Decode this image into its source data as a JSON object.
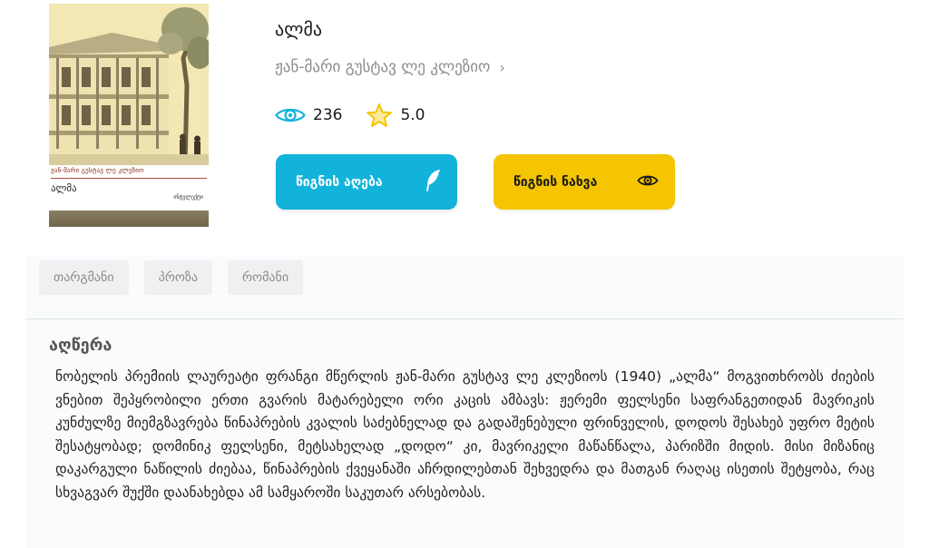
{
  "book": {
    "title": "ალმა",
    "author": "ჟან-მარი გუსტავ ლე კლეზიო",
    "views": "236",
    "rating": "5.0",
    "cover": {
      "author_line": "ჟან-მარი გუსტავ ლე კლეზიო",
      "title": "ალმა",
      "publisher": "ინტელექტი"
    }
  },
  "actions": {
    "take_label": "წიგნის აღება",
    "read_label": "წიგნის ნახვა"
  },
  "tags": [
    "თარგმანი",
    "პროზა",
    "რომანი"
  ],
  "description": {
    "heading": "აღწერა",
    "text": "ნობელის პრემიის ლაურეატი ფრანგი მწერლის ჟან-მარი გუსტავ ლე კლეზიოს (1940) „ალმა“ მოგვითხრობს ძიების ვნებით შეპყრობილი ერთი გვარის მატარებელი ორი კაცის ამბავს: ჟერემი ფელსენი საფრანგეთიდან მავრიკის კუნძულზე მიემგზავრება წინაპრების კვალის საძებნელად და გადაშენებული ფრინველის, დოდოს შესახებ უფრო მეტის შესატყობად; დომინიკ ფელსენი, მეტსახელად „დოდო“ კი, მავრიკელი მაწანწალა, პარიზში მიდის. მისი მიზანიც დაკარგული ნაწილის ძიებაა, წინაპრების ქვეყანაში აჩრდილებთან შეხვედრა და მათგან რაღაც ისეთის შეტყობა, რაც სხვაგვარ შუქში დაანახებდა ამ სამყაროში საკუთარ არსებობას."
  },
  "colors": {
    "take_button": "#12b3db",
    "read_button": "#f4c500",
    "eye_icon": "#12b3db",
    "star_icon": "#f4c500"
  }
}
